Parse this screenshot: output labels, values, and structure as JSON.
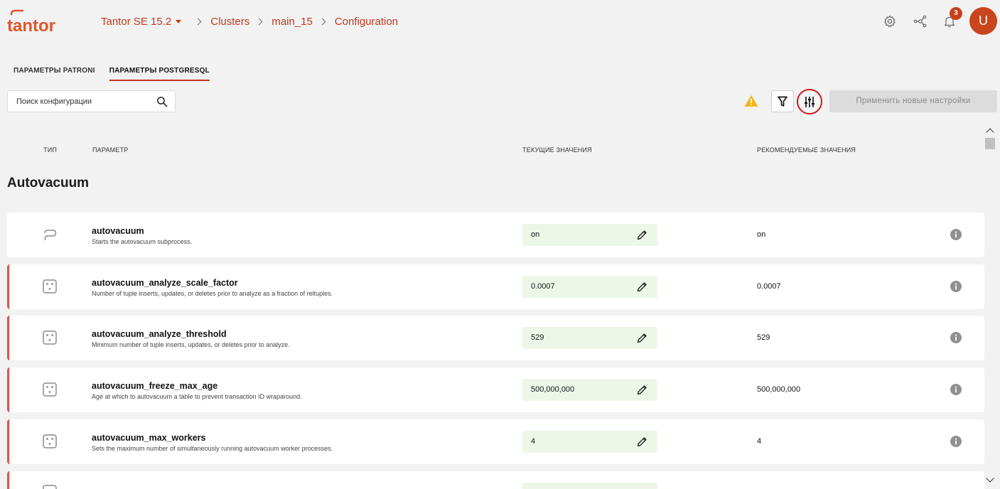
{
  "header": {
    "logo_text": "tantor",
    "breadcrumb": [
      "Tantor SE 15.2",
      "Clusters",
      "main_15",
      "Configuration"
    ],
    "notifications_count": "3",
    "avatar_initial": "U"
  },
  "tabs": [
    {
      "label": "ПАРАМЕТРЫ PATRONI",
      "active": false
    },
    {
      "label": "ПАРАМЕТРЫ POSTGRESQL",
      "active": true
    }
  ],
  "toolbar": {
    "search_placeholder": "Поиск конфигурации",
    "apply_label": "Применить новые настройки"
  },
  "table": {
    "columns": {
      "type": "ТИП",
      "param": "ПАРАМЕТР",
      "current": "ТЕКУЩИЕ ЗНАЧЕНИЯ",
      "recommended": "РЕКОМЕНДУЕМЫЕ ЗНАЧЕНИЯ"
    },
    "section": "Autovacuum",
    "rows": [
      {
        "name": "autovacuum",
        "desc": "Starts the autovacuum subprocess.",
        "current": "on",
        "recommended": "on",
        "type_icon": "toggle-icon",
        "marked": false
      },
      {
        "name": "autovacuum_analyze_scale_factor",
        "desc": "Number of tuple inserts, updates, or deletes prior to analyze as a fraction of reltuples.",
        "current": "0.0007",
        "recommended": "0.0007",
        "type_icon": "number-icon",
        "marked": true
      },
      {
        "name": "autovacuum_analyze_threshold",
        "desc": "Minimum number of tuple inserts, updates, or deletes prior to analyze.",
        "current": "529",
        "recommended": "529",
        "type_icon": "number-icon",
        "marked": true
      },
      {
        "name": "autovacuum_freeze_max_age",
        "desc": "Age at which to autovacuum a table to prevent transaction ID wraparound.",
        "current": "500,000,000",
        "recommended": "500,000,000",
        "type_icon": "number-icon",
        "marked": true
      },
      {
        "name": "autovacuum_max_workers",
        "desc": "Sets the maximum number of simultaneously running autovacuum worker processes.",
        "current": "4",
        "recommended": "4",
        "type_icon": "number-icon",
        "marked": true
      }
    ]
  },
  "colors": {
    "accent": "#c0391b",
    "marker": "#e0524a",
    "current_bg": "#edf7e8"
  }
}
